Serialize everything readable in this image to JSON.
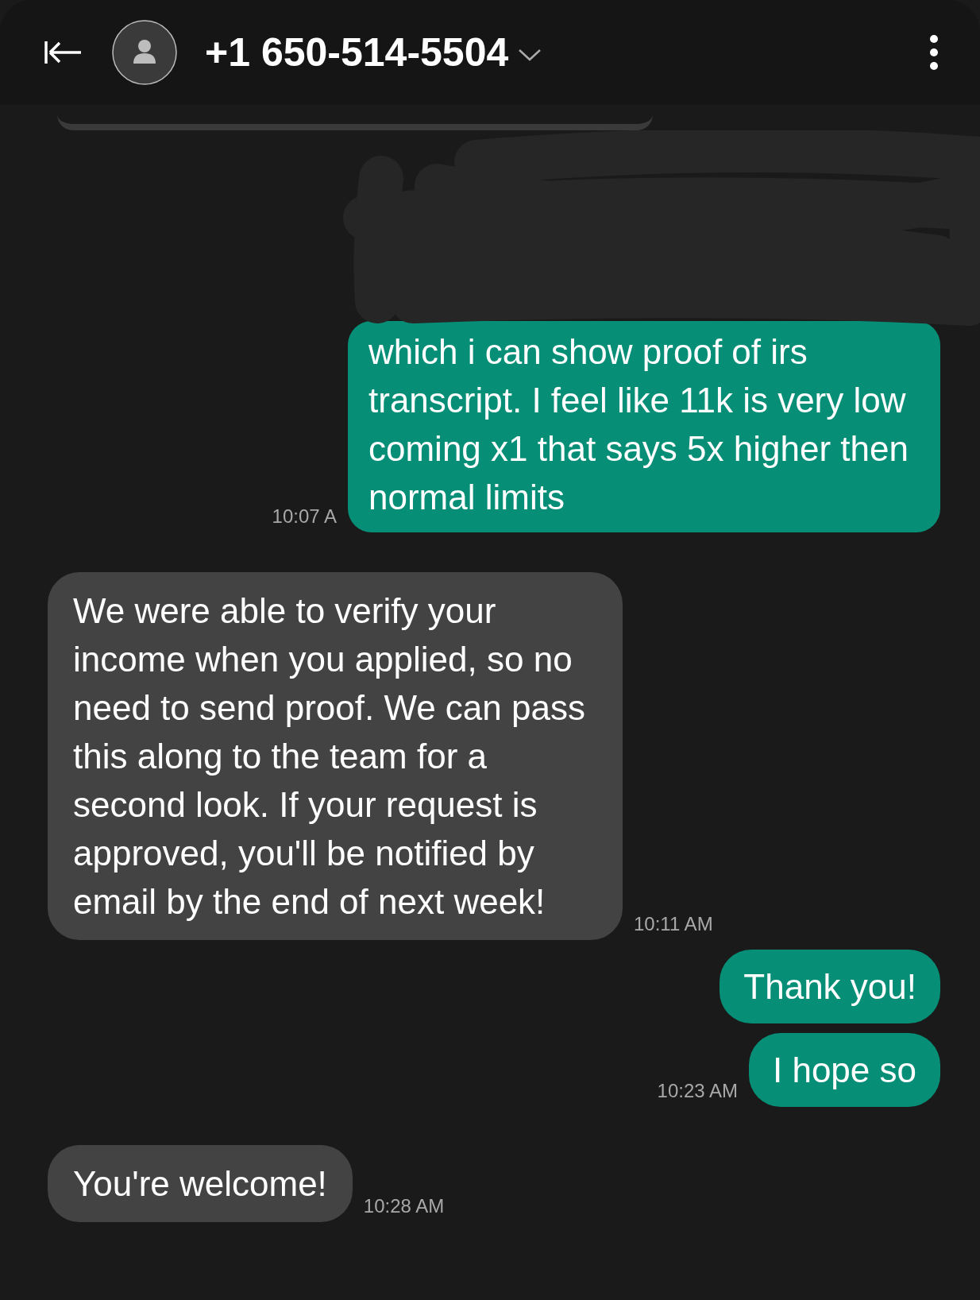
{
  "header": {
    "contact": "+1 650-514-5504"
  },
  "messages": [
    {
      "kind": "sent",
      "redacted": true,
      "text": "which i can show proof of irs transcript. I feel like 11k is very low coming x1 that says 5x higher then normal limits",
      "time": "10:07 A"
    },
    {
      "kind": "received",
      "redacted": false,
      "text": "We were able to verify your income when you applied, so no need to send proof. We can pass this along to the team for a second look. If your request is approved, you'll be notified by email by the end of next week!",
      "time": "10:11 AM"
    },
    {
      "kind": "sent",
      "redacted": false,
      "text": "Thank you!"
    },
    {
      "kind": "sent",
      "redacted": false,
      "text": "I hope so",
      "time": "10:23 AM"
    },
    {
      "kind": "received",
      "redacted": false,
      "text": "You're welcome!",
      "time": "10:28 AM"
    }
  ]
}
